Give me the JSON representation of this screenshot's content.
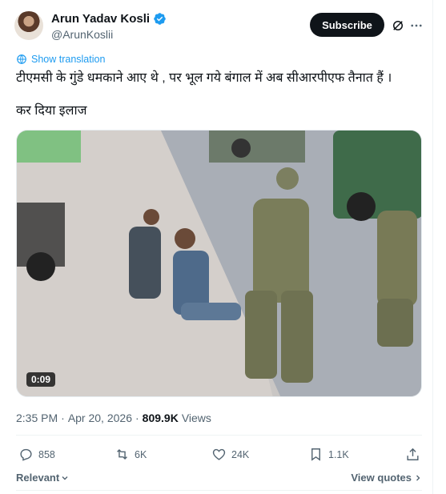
{
  "author": {
    "display_name": "Arun Yadav Kosli",
    "handle": "@ArunKoslii",
    "avatar_icon": "profile-avatar",
    "verified_color": "#1d9bf0"
  },
  "header": {
    "subscribe_label": "Subscribe",
    "grok_icon": "grok-icon",
    "more_icon": "more-icon"
  },
  "translation": {
    "label": "Show translation",
    "icon": "globe-icon"
  },
  "tweet": {
    "line1": "टीएमसी के गुंडे धमकाने आए थे , पर भूल गये बंगाल में अब सीआरपीएफ तैनात हैं ।",
    "line2": "कर दिया इलाज"
  },
  "media": {
    "type": "video",
    "duration": "0:09"
  },
  "meta": {
    "time": "2:35 PM",
    "separator": "·",
    "date": "Apr 20, 2026",
    "separator2": "·",
    "views_count": "809.9K",
    "views_label": "Views"
  },
  "actions": {
    "replies": "858",
    "reposts": "6K",
    "likes": "24K",
    "bookmarks": "1.1K"
  },
  "footer": {
    "sort_label": "Relevant",
    "quotes_label": "View quotes"
  },
  "colors": {
    "accent": "#1d9bf0",
    "text": "#0f1419",
    "secondary": "#536471"
  }
}
